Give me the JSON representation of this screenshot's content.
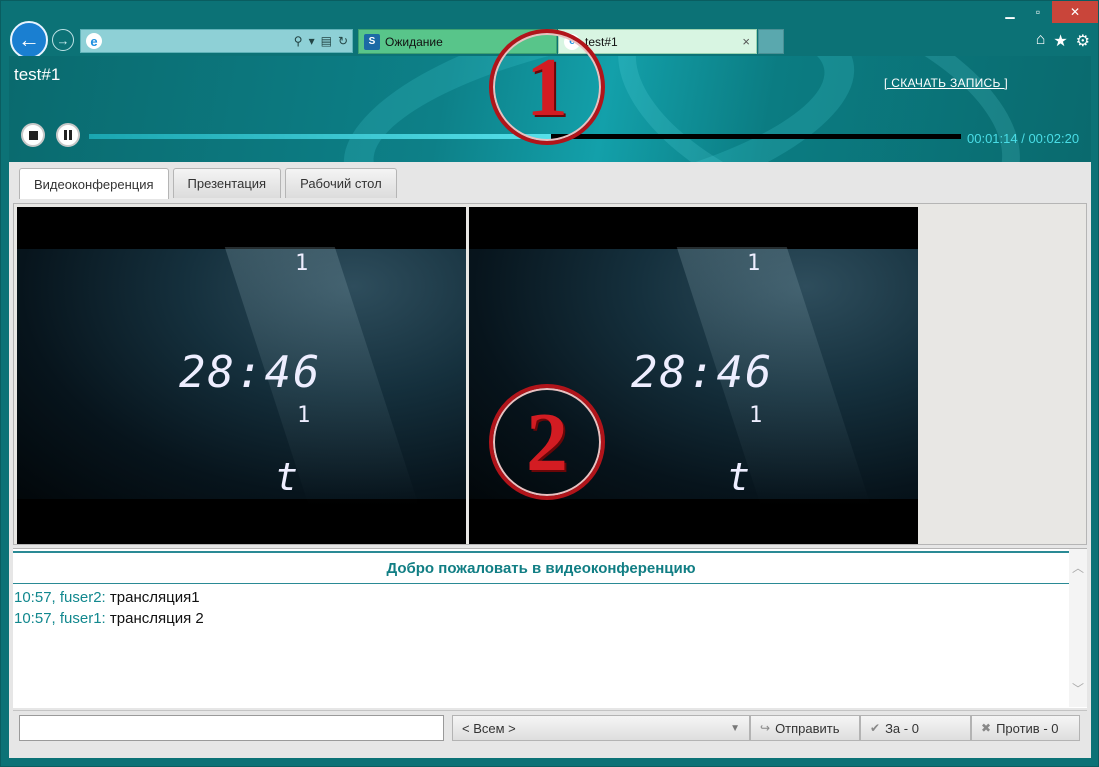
{
  "browser": {
    "address_value": "",
    "tabs": [
      {
        "label": "Ожидание",
        "favicon": "S"
      },
      {
        "label": "test#1",
        "favicon": "e",
        "close": "×"
      }
    ],
    "icons": [
      "home-icon",
      "star-icon",
      "gear-icon"
    ]
  },
  "player": {
    "title": "test#1",
    "download_link": "[ СКАЧАТЬ ЗАПИСЬ ]",
    "time_display": "00:01:14 / 00:02:20",
    "progress": 0.53
  },
  "markers": {
    "one": "1",
    "two": "2"
  },
  "content_tabs": [
    "Видеоконференция",
    "Презентация",
    "Рабочий стол"
  ],
  "videos": [
    {
      "clock": "28:46",
      "digits": [
        "1",
        "1",
        "t"
      ]
    },
    {
      "clock": "28:46",
      "digits": [
        "1",
        "1",
        "t"
      ]
    }
  ],
  "chat": {
    "welcome": "Добро пожаловать в видеоконференцию",
    "messages": [
      {
        "meta": "10:57, fuser2:",
        "text": "трансляция1"
      },
      {
        "meta": "10:57, fuser1:",
        "text": "трансляция 2"
      }
    ]
  },
  "controls": {
    "input_value": "",
    "recipient": "< Всем >",
    "send": "Отправить",
    "vote_for": "За - 0",
    "vote_against": "Против - 0"
  },
  "colors": {
    "accent": "#117e84",
    "header": "#0c7276",
    "marker": "#d31c22"
  }
}
